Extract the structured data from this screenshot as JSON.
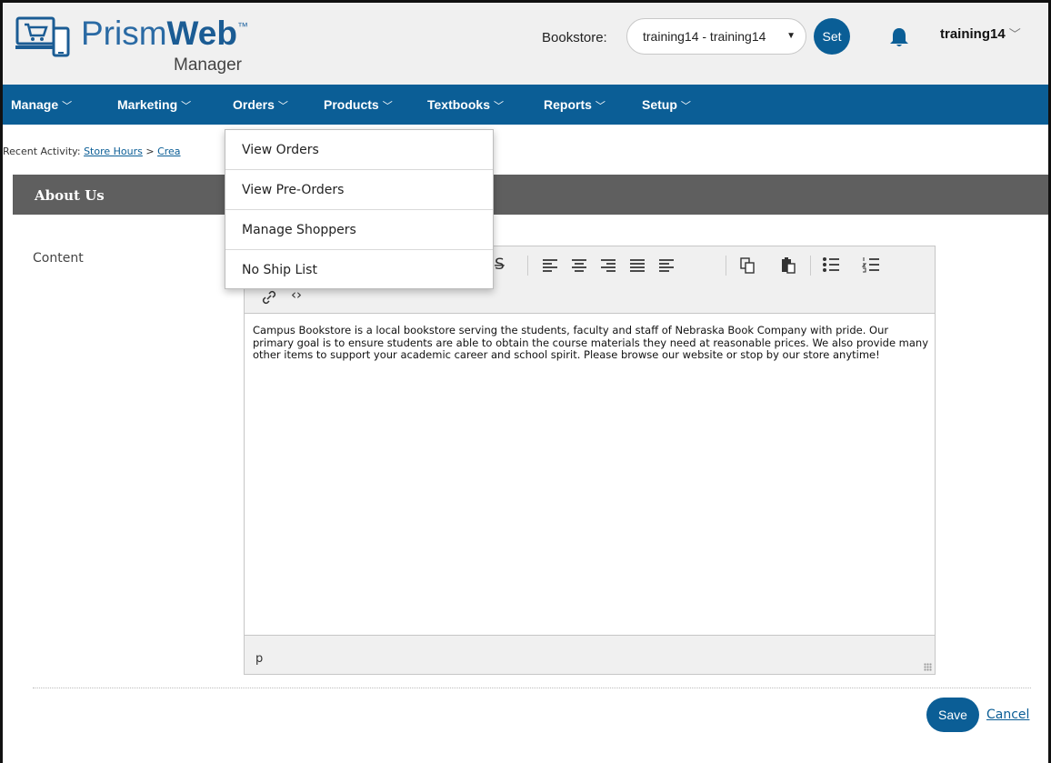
{
  "header": {
    "logo_name": "Prism",
    "logo_bold": "Web",
    "logo_tm": "™",
    "logo_sub": "Manager",
    "bookstore_label": "Bookstore:",
    "bookstore_value": "training14 - training14",
    "set_label": "Set",
    "user": "training14",
    "icons": [
      "cart-laptop-logo-icon",
      "bell-icon",
      "chevron-down-icon"
    ]
  },
  "nav": {
    "items": [
      {
        "label": "Manage"
      },
      {
        "label": "Marketing"
      },
      {
        "label": "Orders"
      },
      {
        "label": "Products"
      },
      {
        "label": "Textbooks"
      },
      {
        "label": "Reports"
      },
      {
        "label": "Setup"
      }
    ],
    "chevron": "﹀"
  },
  "recent": {
    "label": "Recent Activity:",
    "link1": "Store Hours",
    "sep": ">",
    "link2": "Crea"
  },
  "section": {
    "title": "About Us"
  },
  "form": {
    "content_label": "Content",
    "editor_text": "Campus Bookstore is a local bookstore serving the students, faculty and staff of Nebraska Book Company with pride. Our primary goal is to ensure students are able to obtain the course materials they need at reasonable prices. We also provide many other items to support your academic career and school spirit. Please browse our website or stop by our store anytime!",
    "status_path": "p",
    "toolbar_icons": [
      "strikethrough-icon",
      "align-left-icon",
      "align-center-icon",
      "align-right-icon",
      "align-justify-icon",
      "indent-icon",
      "copy-icon",
      "paste-icon",
      "bullet-list-icon",
      "numbered-list-icon",
      "link-icon",
      "source-code-icon"
    ]
  },
  "actions": {
    "save_label": "Save",
    "cancel_label": "Cancel"
  },
  "dropdown": {
    "items": [
      {
        "label": "View Orders"
      },
      {
        "label": "View Pre-Orders"
      },
      {
        "label": "Manage Shoppers"
      },
      {
        "label": "No Ship List"
      }
    ]
  },
  "colors": {
    "brand_blue": "#0b5e96",
    "section_gray": "#5f5f5f",
    "header_bg": "#f0f0f0"
  }
}
